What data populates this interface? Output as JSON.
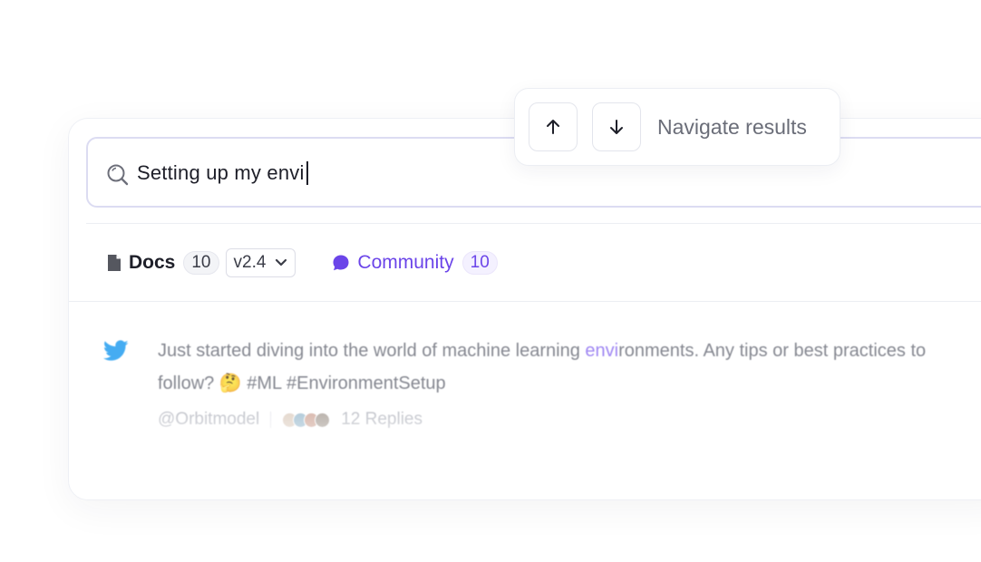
{
  "search": {
    "query": "Setting up my envi"
  },
  "tabs": {
    "docs": {
      "label": "Docs",
      "count": "10",
      "version": "v2.4"
    },
    "community": {
      "label": "Community",
      "count": "10"
    }
  },
  "result": {
    "source_icon": "twitter-icon",
    "text_before": "Just started diving into the world of machine learning ",
    "highlight": "envi",
    "text_after": "ronments. Any tips or best practices to",
    "line2": "follow? 🤔 #ML #EnvironmentSetup",
    "author": "@Orbitmodel",
    "replies": "12 Replies"
  },
  "navigate": {
    "label": "Navigate results",
    "up_icon": "arrow-up-icon",
    "down_icon": "arrow-down-icon"
  },
  "colors": {
    "accent": "#6b45e9",
    "twitter": "#1d9bf0",
    "highlight": "#8a6cf0"
  }
}
